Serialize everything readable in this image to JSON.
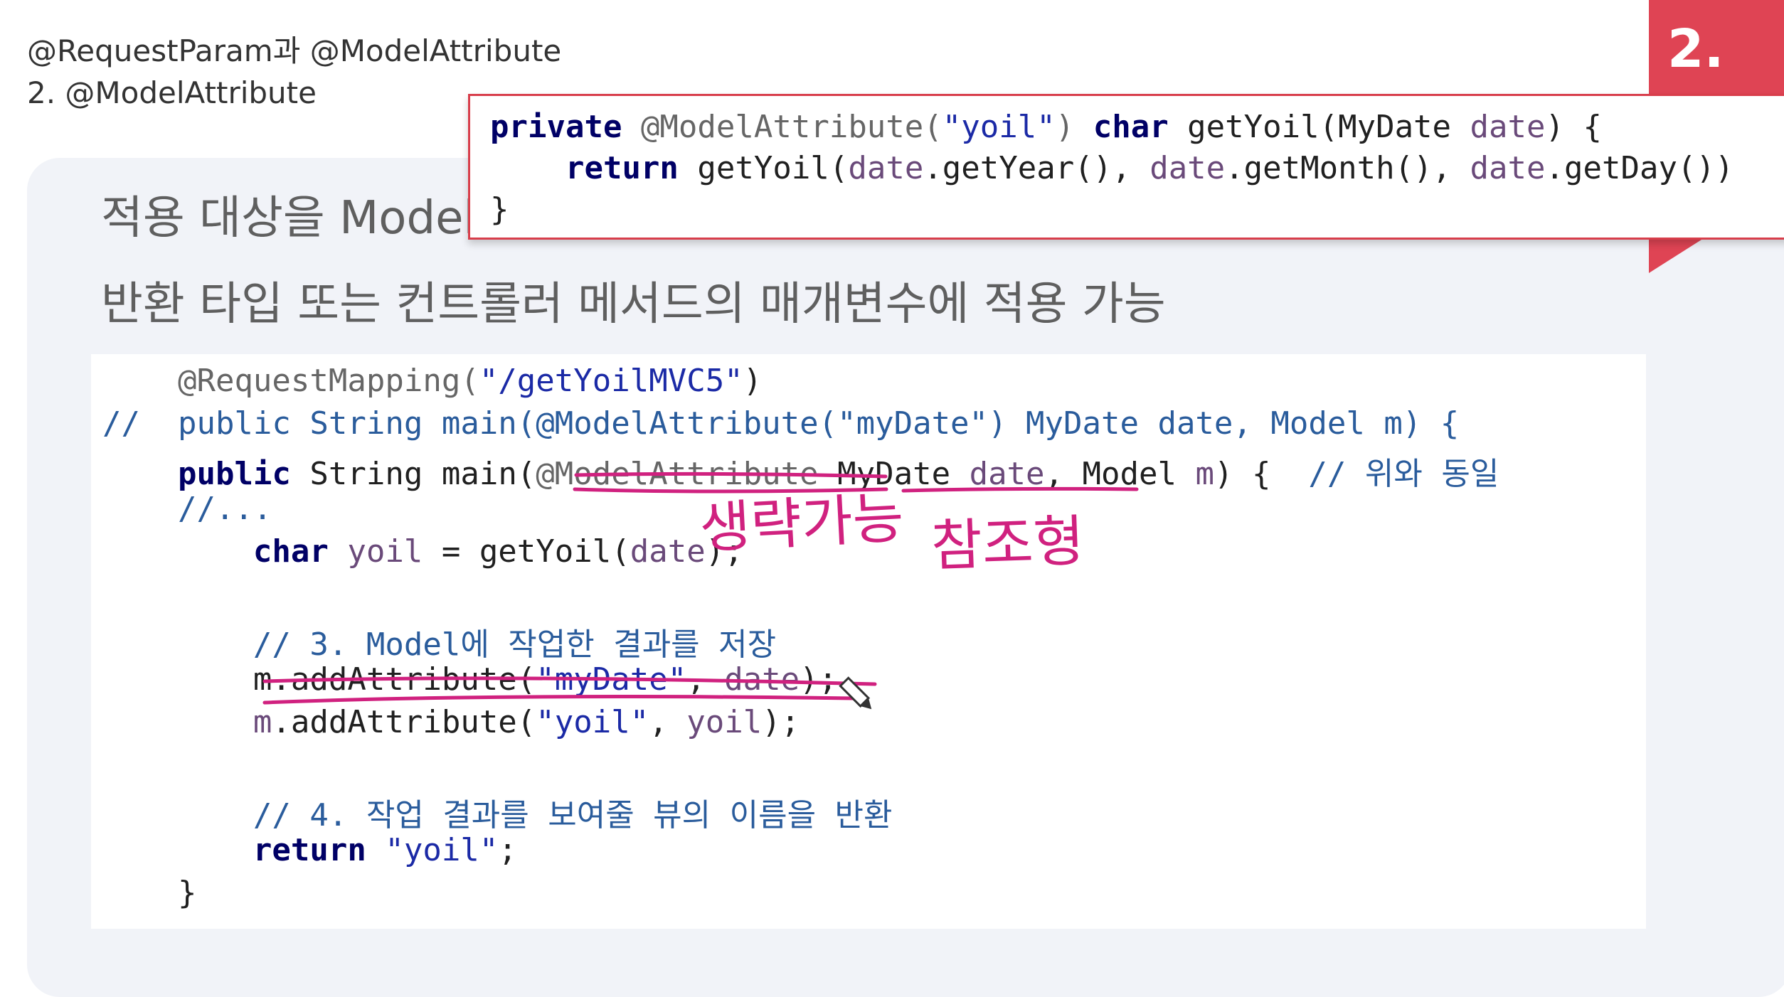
{
  "header": {
    "title": "@RequestParam과 @ModelAttribute",
    "subtitle": "2. @ModelAttribute"
  },
  "slide": {
    "number": "2.",
    "heading1": "적용 대상을 Model",
    "heading2": "반환 타입 또는 컨트롤러 메서드의 매개변수에 적용 가능"
  },
  "popup_code": {
    "line1": {
      "kw": "private",
      "ann": " @ModelAttribute(",
      "str": "\"yoil\"",
      "rest1": ") ",
      "kw2": "char",
      "rest2": " getYoil(MyDate ",
      "var": "date",
      "rest3": ") {"
    },
    "line2": {
      "kw": "return",
      "rest": " getYoil(",
      "v1": "date",
      "m1": ".getYear(), ",
      "v2": "date",
      "m2": ".getMonth(), ",
      "v3": "date",
      "m3": ".getDay())"
    },
    "line3": "}"
  },
  "code": {
    "l1_ann": "@RequestMapping(",
    "l1_str": "\"/getYoilMVC5\"",
    "l1_end": ")",
    "l2": "//  public String main(@ModelAttribute(\"myDate\") MyDate date, Model m) {",
    "l3_kw": "public",
    "l3_a": " String main(",
    "l3_strike": "@ModelAttribute",
    "l3_b": " MyDate ",
    "l3_var": "date",
    "l3_c": ", Model ",
    "l3_m": "m",
    "l3_d": ") {  ",
    "l3_com": "// 위와 동일",
    "l4": "//...",
    "l5_kw": "char",
    "l5_var": " yoil",
    "l5_a": " = getYoil(",
    "l5_arg": "date",
    "l5_b": ");",
    "l6": "// 3. Model에 작업한 결과를 저장",
    "l7_a": "m.addAttribute(",
    "l7_str": "\"myDate\"",
    "l7_b": ", ",
    "l7_var": "date",
    "l7_c": ");",
    "l8_m": "m",
    "l8_a": ".addAttribute(",
    "l8_str": "\"yoil\"",
    "l8_b": ", ",
    "l8_var": "yoil",
    "l8_c": ");",
    "l9": "// 4. 작업 결과를 보여줄 뷰의 이름을 반환",
    "l10_kw": "return",
    "l10_str": " \"yoil\"",
    "l10_end": ";",
    "l11": "}"
  },
  "handwriting": {
    "note1": "생략가능",
    "note2": "참조형"
  },
  "colors": {
    "ink": "#d0217f",
    "tab_red": "#df4454",
    "panel_bg": "#f1f3f8"
  }
}
